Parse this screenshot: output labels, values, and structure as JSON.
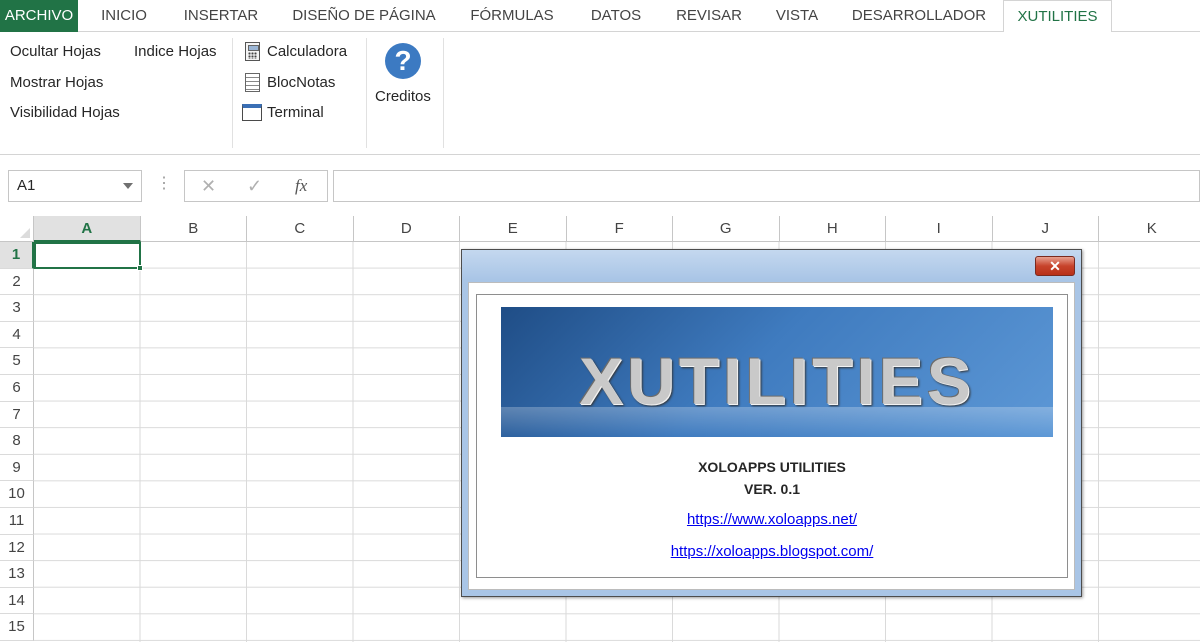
{
  "tabs": [
    {
      "label": "ARCHIVO",
      "type": "file"
    },
    {
      "label": "INICIO"
    },
    {
      "label": "INSERTAR"
    },
    {
      "label": "DISEÑO DE PÁGINA"
    },
    {
      "label": "FÓRMULAS"
    },
    {
      "label": "DATOS"
    },
    {
      "label": "REVISAR"
    },
    {
      "label": "VISTA"
    },
    {
      "label": "DESARROLLADOR"
    },
    {
      "label": "XUTILITIES",
      "active": true
    }
  ],
  "ribbon": {
    "hojas": {
      "ocultar": "Ocultar Hojas",
      "indice": "Indice Hojas",
      "mostrar": "Mostrar Hojas",
      "visibilidad": "Visibilidad Hojas"
    },
    "herramientas": {
      "calculadora": "Calculadora",
      "blocnotas": "BlocNotas",
      "terminal": "Terminal"
    },
    "creditos": "Creditos",
    "help_glyph": "?"
  },
  "formula_bar": {
    "name_box": "A1",
    "dots": "⋮",
    "cancel_glyph": "✕",
    "enter_glyph": "✓",
    "fx_label": "fx",
    "formula": ""
  },
  "grid": {
    "columns": [
      "A",
      "B",
      "C",
      "D",
      "E",
      "F",
      "G",
      "H",
      "I",
      "J",
      "K"
    ],
    "rows": [
      "1",
      "2",
      "3",
      "4",
      "5",
      "6",
      "7",
      "8",
      "9",
      "10",
      "11",
      "12",
      "13",
      "14",
      "15"
    ],
    "selected_column": "A",
    "selected_row": "1"
  },
  "dialog": {
    "close_glyph": "✕",
    "banner_text": "XUTILITIES",
    "title": "XOLOAPPS UTILITIES",
    "version": "VER. 0.1",
    "link1": "https://www.xoloapps.net/",
    "link2": "https://xoloapps.blogspot.com/"
  },
  "colors": {
    "excel_green": "#217346",
    "link_blue": "#0000ee",
    "dialog_frame": "#a9c5e6"
  }
}
